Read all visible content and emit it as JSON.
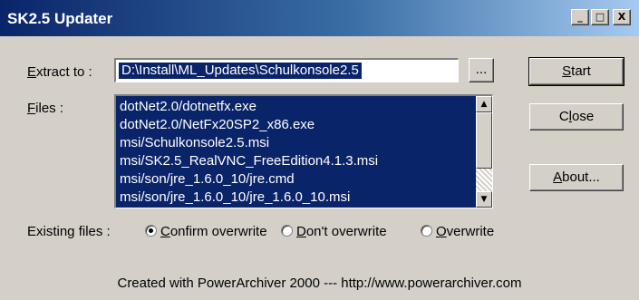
{
  "window": {
    "title": "SK2.5 Updater",
    "caption_buttons": [
      "_",
      "□",
      "X"
    ]
  },
  "extract": {
    "label_prefix": "",
    "label_accel": "E",
    "label_rest": "xtract to :",
    "value": "D:\\Install\\ML_Updates\\Schulkonsole2.5",
    "browse_label": "..."
  },
  "files": {
    "label_accel": "F",
    "label_rest": "iles :",
    "items": [
      "dotNet2.0/dotnetfx.exe",
      "dotNet2.0/NetFx20SP2_x86.exe",
      "msi/Schulkonsole2.5.msi",
      "msi/SK2.5_RealVNC_FreeEdition4.1.3.msi",
      "msi/son/jre_1.6.0_10/jre.cmd",
      "msi/son/jre_1.6.0_10/jre_1.6.0_10.msi"
    ]
  },
  "buttons": {
    "start": {
      "accel": "S",
      "rest": "tart"
    },
    "close": {
      "prefix": "C",
      "accel": "l",
      "rest": "ose"
    },
    "about": {
      "accel": "A",
      "rest": "bout..."
    }
  },
  "existing": {
    "label": "Existing files :",
    "options": [
      {
        "accel": "C",
        "rest": "onfirm overwrite",
        "selected": true
      },
      {
        "accel": "D",
        "rest": "on't overwrite",
        "selected": false
      },
      {
        "accel": "O",
        "rest": "verwrite",
        "selected": false
      }
    ]
  },
  "footer": "Created with PowerArchiver 2000 --- http://www.powerarchiver.com"
}
